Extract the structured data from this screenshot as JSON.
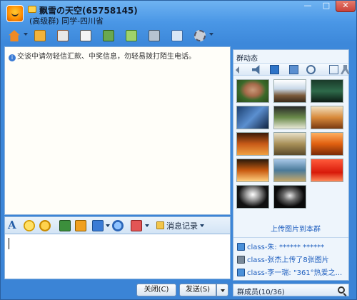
{
  "window": {
    "title": "飘雪の天空(65758145)",
    "subtitle": "(高级群) 同学-四川省",
    "minimize_glyph": "—",
    "maximize_glyph": "□",
    "close_glyph": "✕"
  },
  "toolbar": {
    "icons": [
      "home-icon",
      "folder-icon",
      "contacts-icon",
      "card-icon",
      "share-icon",
      "computer-icon",
      "tools-icon",
      "announcement-icon",
      "settings-icon"
    ]
  },
  "chat": {
    "notice_icon": "i",
    "notice": "交谈中请勿轻信汇款、中奖信息，勿轻易拨打陌生电话。"
  },
  "format_bar": {
    "font_glyph": "A",
    "icons": [
      "emoji-icon",
      "shake-icon",
      "image-icon",
      "gift-icon",
      "screenshot-icon",
      "music-icon",
      "sticker-icon"
    ],
    "history_label": "消息记录"
  },
  "buttons": {
    "close": "关闭(C)",
    "send": "发送(S)"
  },
  "group_panel": {
    "title": "群动态",
    "upload_link": "上传图片到本群",
    "feed": [
      {
        "icon": "badge-icon",
        "text": "class-朱: ****** ******"
      },
      {
        "icon": "photo-icon",
        "text": "class-张杰上传了8张图片"
      },
      {
        "icon": "badge-icon",
        "text": "class-李一瑞: \"361°热爱之..."
      }
    ]
  },
  "members": {
    "label": "群成员(10/36)"
  },
  "colors": {
    "title_bar": "#4a97e6",
    "chat_bg": "#fffef9",
    "link": "#1f5fbf",
    "close_button": "#c8413a"
  }
}
